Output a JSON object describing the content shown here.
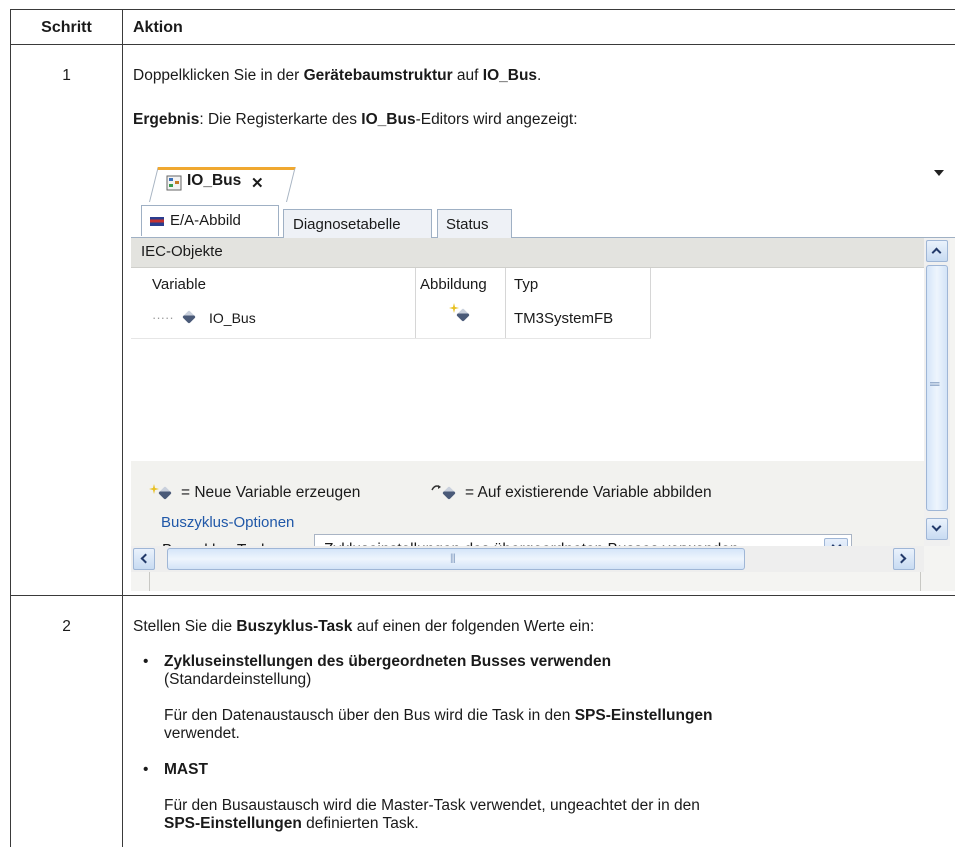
{
  "table": {
    "col_step": "Schritt",
    "col_action": "Aktion",
    "row1": {
      "step": "1",
      "line1_pre": "Doppelklicken Sie in der ",
      "line1_b1": "Gerätebaumstruktur",
      "line1_mid": " auf ",
      "line1_b2": "IO_Bus",
      "line1_end": ".",
      "line2_b1": "Ergebnis",
      "line2_mid": ": Die Registerkarte des ",
      "line2_b2": "IO_Bus",
      "line2_end": "-Editors wird angezeigt:"
    },
    "row2": {
      "step": "2",
      "intro_pre": "Stellen Sie die ",
      "intro_b": "Buszyklus-Task",
      "intro_end": " auf einen der folgenden Werte ein:",
      "bullet1_b": "Zykluseinstellungen des übergeordneten Busses verwenden",
      "bullet1_note": "(Standardeinstellung)",
      "bullet1_desc_pre": "Für den Datenaustausch über den Bus wird die Task in den ",
      "bullet1_desc_b": "SPS-Einstellungen",
      "bullet1_desc_end": "verwendet.",
      "bullet2_b": "MAST",
      "bullet2_desc1": "Für den Busaustausch wird die Master-Task verwendet, ungeachtet der in den",
      "bullet2_desc2_b": "SPS-Einstellungen",
      "bullet2_desc2_end": " definierten Task.",
      "bullet_char": "•"
    }
  },
  "editor": {
    "doc_tab_label": "IO_Bus",
    "close_label": "✕",
    "tabs": [
      "E/A-Abbild",
      "Diagnosetabelle",
      "Status"
    ],
    "group_header": "IEC-Objekte",
    "columns": [
      "Variable",
      "Abbildung",
      "Typ"
    ],
    "row": {
      "variable": "IO_Bus",
      "type": "TM3SystemFB",
      "tree_prefix": "·····"
    },
    "legend_new": "= Neue Variable erzeugen",
    "legend_map": "= Auf existierende Variable abbilden",
    "bus_group_title": "Buszyklus-Optionen",
    "bus_task_label": "Buszyklus-Task",
    "bus_task_value": "Zykluseinstellungen des übergeordneten Busses verwenden",
    "scroll_grip": "|||"
  },
  "colors": {
    "accent_tab": "#f0a830",
    "group_title": "#2058a8",
    "border": "#3a3a3a"
  }
}
